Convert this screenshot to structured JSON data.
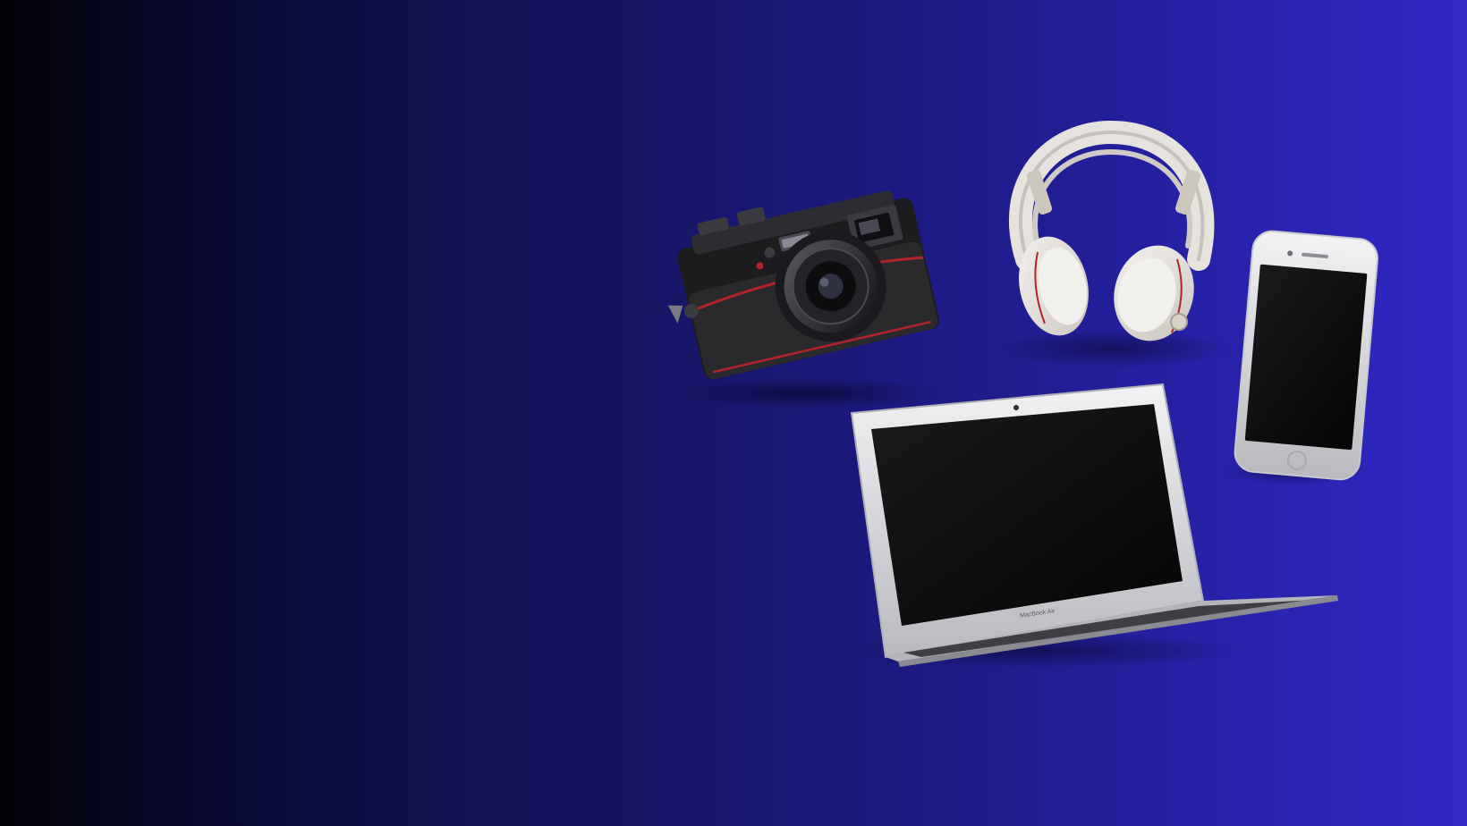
{
  "banner": {
    "background_colors": [
      "#020208",
      "#15135c",
      "#1a197a",
      "#3129c6"
    ]
  },
  "products": [
    {
      "kind": "camera",
      "icon": "camera-icon"
    },
    {
      "kind": "headphones",
      "icon": "headphones-icon"
    },
    {
      "kind": "smartphone",
      "icon": "smartphone-icon"
    },
    {
      "kind": "laptop",
      "icon": "laptop-icon",
      "brand_label": "MacBook Air"
    }
  ],
  "colors": {
    "device_black": "#141416",
    "device_silver": "#d9dadd",
    "accent_red": "#b3232a",
    "headphone_white": "#e9e6e2"
  }
}
